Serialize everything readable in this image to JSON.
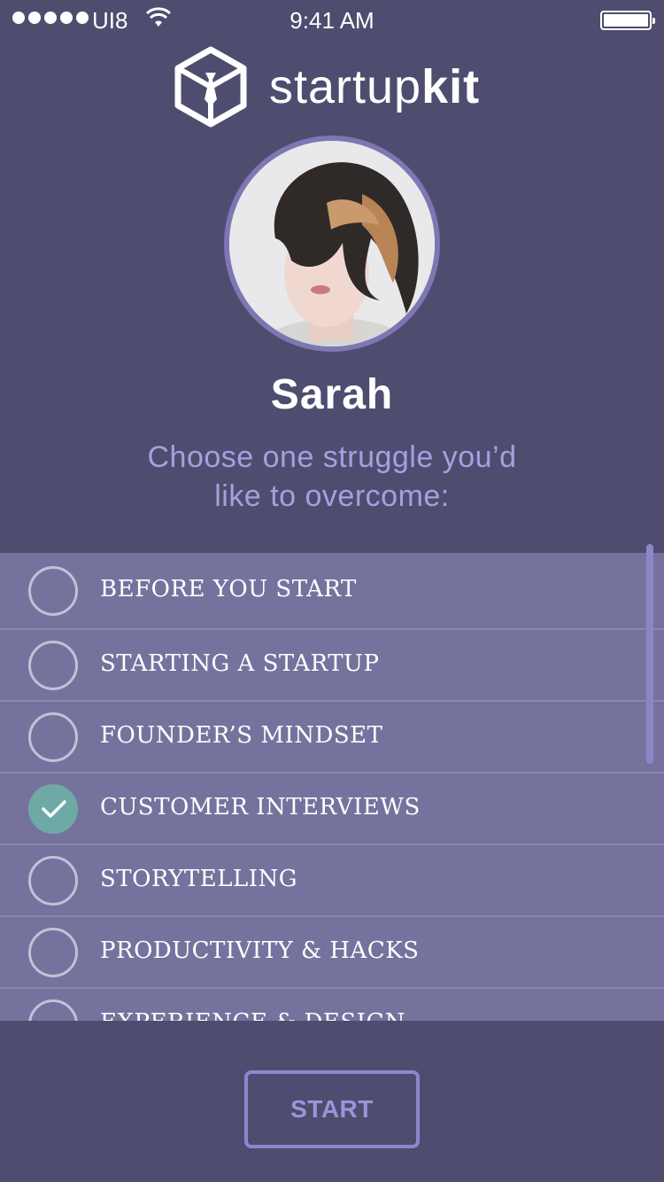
{
  "status_bar": {
    "carrier": "UI8",
    "time": "9:41 AM",
    "signal_dots": 5,
    "battery_level": 1.0
  },
  "logo": {
    "text_light": "startup",
    "text_bold": "kit",
    "icon": "box-tie-icon"
  },
  "profile": {
    "name": "Sarah",
    "avatar": "avatar-photo"
  },
  "prompt": {
    "line1": "Choose one struggle you’d",
    "line2": "like to overcome:"
  },
  "struggles": [
    {
      "label": "BEFORE YOU START",
      "selected": false
    },
    {
      "label": "STARTING A STARTUP",
      "selected": false
    },
    {
      "label": "FOUNDER’S MINDSET",
      "selected": false
    },
    {
      "label": "CUSTOMER INTERVIEWS",
      "selected": true
    },
    {
      "label": "STORYTELLING",
      "selected": false
    },
    {
      "label": "PRODUCTIVITY & HACKS",
      "selected": false
    },
    {
      "label": "EXPERIENCE & DESIGN",
      "selected": false
    }
  ],
  "footer": {
    "start_label": "START"
  },
  "colors": {
    "background": "#4e4d6f",
    "list_row": "#75739d",
    "accent": "#8f86d0",
    "selected": "#6fa9a6",
    "prompt_text": "#a89ee0"
  }
}
